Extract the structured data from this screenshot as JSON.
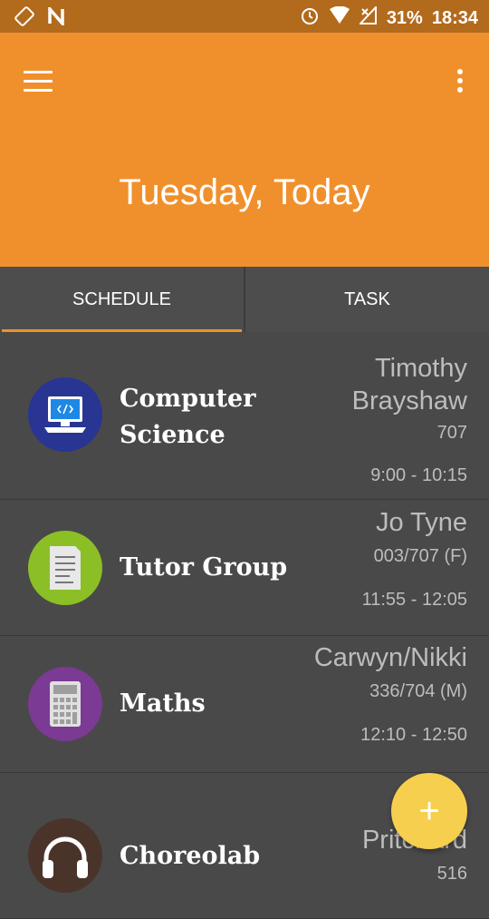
{
  "status": {
    "battery": "31%",
    "time": "18:34"
  },
  "header": {
    "title": "Tuesday, Today"
  },
  "tabs": [
    {
      "label": "SCHEDULE"
    },
    {
      "label": "TASK"
    }
  ],
  "schedule": [
    {
      "subject_line1": "Computer",
      "subject_line2": "Science",
      "teacher_line1": "Timothy",
      "teacher_line2": "Brayshaw",
      "room": "707",
      "time": "9:00 - 10:15",
      "icon": "computer-icon",
      "color": "#283593"
    },
    {
      "subject_line1": "Tutor Group",
      "teacher_line1": "Jo Tyne",
      "room": "003/707 (F)",
      "time": "11:55 - 12:05",
      "icon": "document-icon",
      "color": "#8cbf26"
    },
    {
      "subject_line1": "Maths",
      "teacher_line1": "Carwyn/Nikki",
      "room": "336/704 (M)",
      "time": "12:10 - 12:50",
      "icon": "calculator-icon",
      "color": "#7b3a93"
    },
    {
      "subject_line1": "Choreolab",
      "teacher_line1": "Pritchard",
      "room": "516",
      "icon": "headphones-icon",
      "color": "#4a342a"
    }
  ],
  "fab": {
    "label": "+"
  }
}
